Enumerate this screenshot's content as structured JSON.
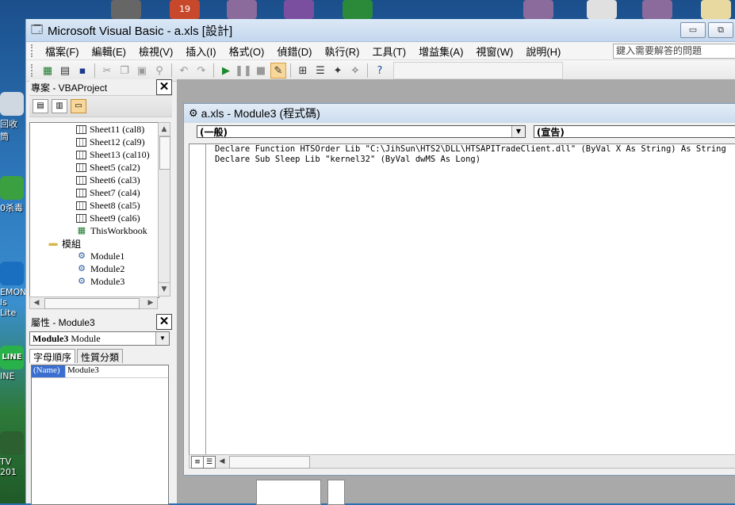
{
  "window": {
    "title": "Microsoft Visual Basic - a.xls [設計]",
    "buttons": {
      "minimize": "▭",
      "restore": "⧉"
    }
  },
  "desktop": {
    "icons": [
      {
        "label": "回收筒"
      },
      {
        "label": "0杀毒"
      },
      {
        "label": "EMON"
      },
      {
        "label": "ls Lite"
      },
      {
        "label": "INE"
      },
      {
        "label": "TV 201"
      }
    ],
    "top_badge": "19",
    "line_logo": "LINE"
  },
  "menu": {
    "items": [
      "檔案(F)",
      "編輯(E)",
      "檢視(V)",
      "插入(I)",
      "格式(O)",
      "偵錯(D)",
      "執行(R)",
      "工具(T)",
      "增益集(A)",
      "視窗(W)",
      "說明(H)"
    ],
    "help_placeholder": "鍵入需要解答的問題"
  },
  "project": {
    "title": "專案 - VBAProject",
    "close": "✕",
    "tree": [
      {
        "label": "Sheet11 (cal8)",
        "type": "sheet",
        "indent": 2
      },
      {
        "label": "Sheet12 (cal9)",
        "type": "sheet",
        "indent": 2
      },
      {
        "label": "Sheet13 (cal10)",
        "type": "sheet",
        "indent": 2
      },
      {
        "label": "Sheet5 (cal2)",
        "type": "sheet",
        "indent": 2
      },
      {
        "label": "Sheet6 (cal3)",
        "type": "sheet",
        "indent": 2
      },
      {
        "label": "Sheet7 (cal4)",
        "type": "sheet",
        "indent": 2
      },
      {
        "label": "Sheet8 (cal5)",
        "type": "sheet",
        "indent": 2
      },
      {
        "label": "Sheet9 (cal6)",
        "type": "sheet",
        "indent": 2
      },
      {
        "label": "ThisWorkbook",
        "type": "workbook",
        "indent": 2
      },
      {
        "label": "模組",
        "type": "folder",
        "indent": 1
      },
      {
        "label": "Module1",
        "type": "module",
        "indent": 2
      },
      {
        "label": "Module2",
        "type": "module",
        "indent": 2
      },
      {
        "label": "Module3",
        "type": "module",
        "indent": 2
      }
    ]
  },
  "properties": {
    "title": "屬性 - Module3",
    "close": "✕",
    "object_name": "Module3",
    "object_type": "Module",
    "tabs": [
      "字母順序",
      "性質分類"
    ],
    "rows": [
      {
        "name": "(Name)",
        "value": "Module3"
      }
    ]
  },
  "code_window": {
    "title": "a.xls - Module3 (程式碼)",
    "object_combo": "(一般)",
    "proc_combo": "(宣告)",
    "lines": [
      "Declare Function HTSOrder Lib \"C:\\JihSun\\HTS2\\DLL\\HTSAPITradeClient.dll\" (ByVal X As String) As String",
      "Declare Sub Sleep Lib \"kernel32\" (ByVal dwMS As Long)"
    ]
  },
  "colors": {
    "accent": "#3a6fd0",
    "highlight": "#f8d89a"
  }
}
